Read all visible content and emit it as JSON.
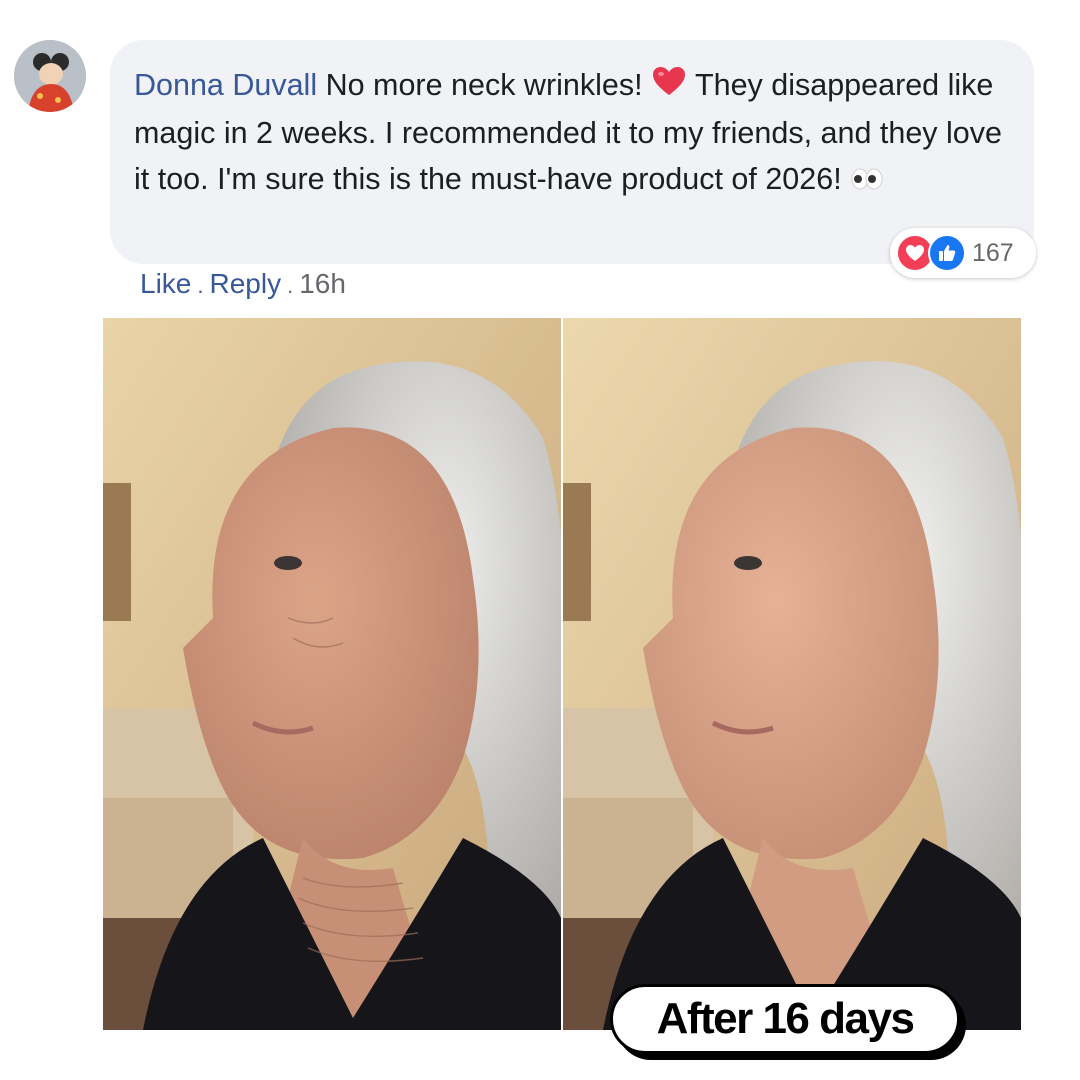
{
  "comment": {
    "author": "Donna Duvall",
    "text_part1": "No more neck wrinkles!",
    "text_part2": "They disappeared like magic in 2 weeks. I recommended it to my friends, and they love it too. I'm sure this is the must-have product of 2026!",
    "emojis": [
      "heart-emoji",
      "eyes-emoji"
    ]
  },
  "reactions": {
    "icons": [
      "love-reaction-icon",
      "like-reaction-icon"
    ],
    "count": "167"
  },
  "actions": {
    "like": "Like",
    "separator": ".",
    "reply": "Reply",
    "time": "16h"
  },
  "photos": {
    "badge_label": "After 16 days"
  },
  "colors": {
    "author_link": "#385898",
    "bubble_bg": "#f0f2f5",
    "love": "#f33e58",
    "like": "#1877f2"
  }
}
